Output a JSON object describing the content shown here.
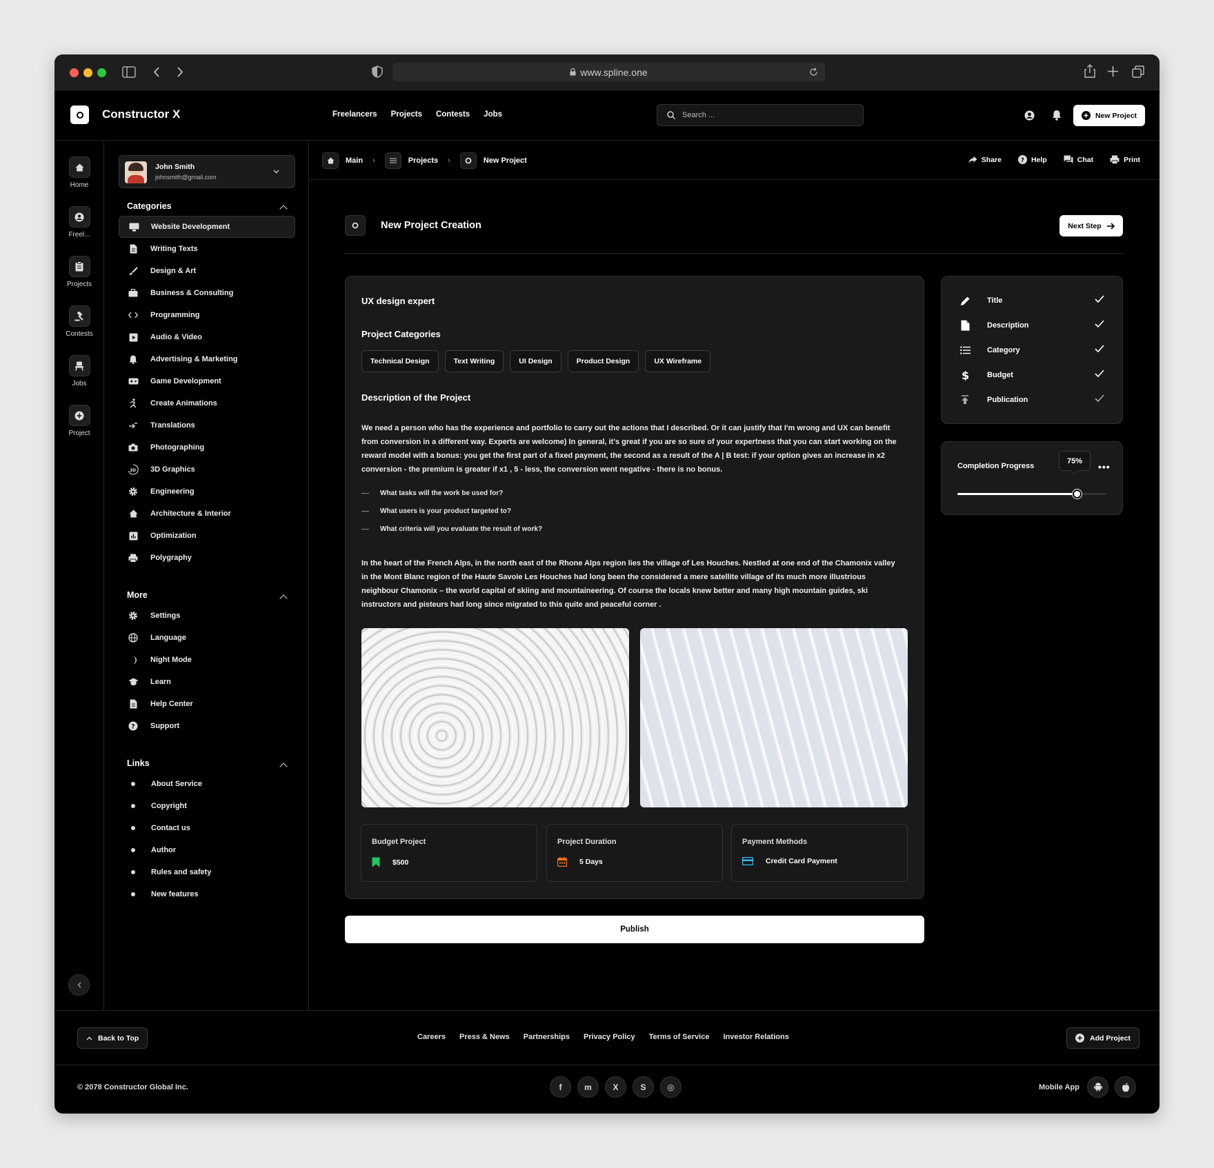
{
  "browser": {
    "url": "www.spline.one"
  },
  "header": {
    "brand": "Constructor X",
    "nav": [
      "Freelancers",
      "Projects",
      "Contests",
      "Jobs"
    ],
    "search_placeholder": "Search ...",
    "new_project": "New Project"
  },
  "rail": [
    {
      "label": "Home",
      "icon": "home-icon"
    },
    {
      "label": "Freel...",
      "icon": "user-circle-icon"
    },
    {
      "label": "Projects",
      "icon": "clipboard-icon"
    },
    {
      "label": "Contests",
      "icon": "gavel-icon"
    },
    {
      "label": "Jobs",
      "icon": "chair-icon"
    },
    {
      "label": "Project",
      "icon": "plus-circle-icon"
    }
  ],
  "user": {
    "name": "John Smith",
    "email": "johnsmith@gmail.com"
  },
  "categories": {
    "title": "Categories",
    "items": [
      "Website Development",
      "Writing Texts",
      "Design & Art",
      "Business & Consulting",
      "Programming",
      "Audio & Video",
      "Advertising & Marketing",
      "Game Development",
      "Create Animations",
      "Translations",
      "Photographing",
      "3D Graphics",
      "Engineering",
      "Architecture & Interior",
      "Optimization",
      "Polygraphy"
    ]
  },
  "more": {
    "title": "More",
    "items": [
      "Settings",
      "Language",
      "Night Mode",
      "Learn",
      "Help Center",
      "Support"
    ]
  },
  "links": {
    "title": "Links",
    "items": [
      "About Service",
      "Copyright",
      "Contact us",
      "Author",
      "Rules and safety",
      "New features"
    ]
  },
  "breadcrumb": [
    "Main",
    "Projects",
    "New Project"
  ],
  "tools": [
    "Share",
    "Help",
    "Chat",
    "Print"
  ],
  "page": {
    "title": "New Project Creation",
    "next": "Next Step"
  },
  "project": {
    "name": "UX design expert",
    "categories_title": "Project Categories",
    "tags": [
      "Technical Design",
      "Text Writing",
      "UI Design",
      "Product Design",
      "UX Wireframe"
    ],
    "desc_title": "Description of the Project",
    "p1_lines": [
      "We need a person who has the experience and portfolio to carry out the actions that I described. Or it can justify that I'm wrong and UX can benefit",
      "from conversion in a different way. Experts are welcome) In general, it's great if you are so sure of your expertness that you can start working on the",
      "reward model with a bonus: you get the first part of a fixed payment, the second as a result of the A | B test: if your option gives an increase in x2",
      "conversion - the premium is greater if x1 , 5 - less, the conversion went negative - there is no bonus."
    ],
    "questions": [
      "What tasks will the work be used for?",
      "What users is your product targeted to?",
      "What criteria will you evaluate the result of work?"
    ],
    "p2_lines": [
      "In the heart of the French Alps, in the north east of the Rhone Alps region lies the village of Les Houches. Nestled at one end of the Chamonix valley",
      "in the Mont Blanc region of the Haute Savoie Les Houches had long been the considered a mere satellite village of its much more illustrious",
      "neighbour Chamonix – the world capital of skiing and mountaineering. Of course the locals knew better and many high mountain guides, ski",
      "instructors and pisteurs had long since migrated to this quite and peaceful corner ."
    ],
    "budget": {
      "label": "Budget Project",
      "value": "$500",
      "color": "#22c55e"
    },
    "duration": {
      "label": "Project Duration",
      "value": "5 Days",
      "color": "#f97316"
    },
    "payment": {
      "label": "Payment Methods",
      "value": "Credit Card Payment",
      "color": "#38bdf8"
    },
    "publish": "Publish"
  },
  "steps": [
    {
      "label": "Title",
      "icon": "pencil-icon"
    },
    {
      "label": "Description",
      "icon": "document-icon"
    },
    {
      "label": "Category",
      "icon": "list-icon"
    },
    {
      "label": "Budget",
      "icon": "dollar-icon"
    },
    {
      "label": "Publication",
      "icon": "upload-icon"
    }
  ],
  "progress": {
    "label": "Completion Progress",
    "value_text": "75%",
    "value": 0.8
  },
  "footer": {
    "back_to_top": "Back to Top",
    "links": [
      "Careers",
      "Press & News",
      "Partnerships",
      "Privacy Policy",
      "Terms of Service",
      "Investor Relations"
    ],
    "add_project": "Add Project",
    "copyright": "© 2078 Constructor Global Inc.",
    "social": [
      "f",
      "m",
      "X",
      "S",
      "◎"
    ],
    "mobile_app": "Mobile App"
  }
}
